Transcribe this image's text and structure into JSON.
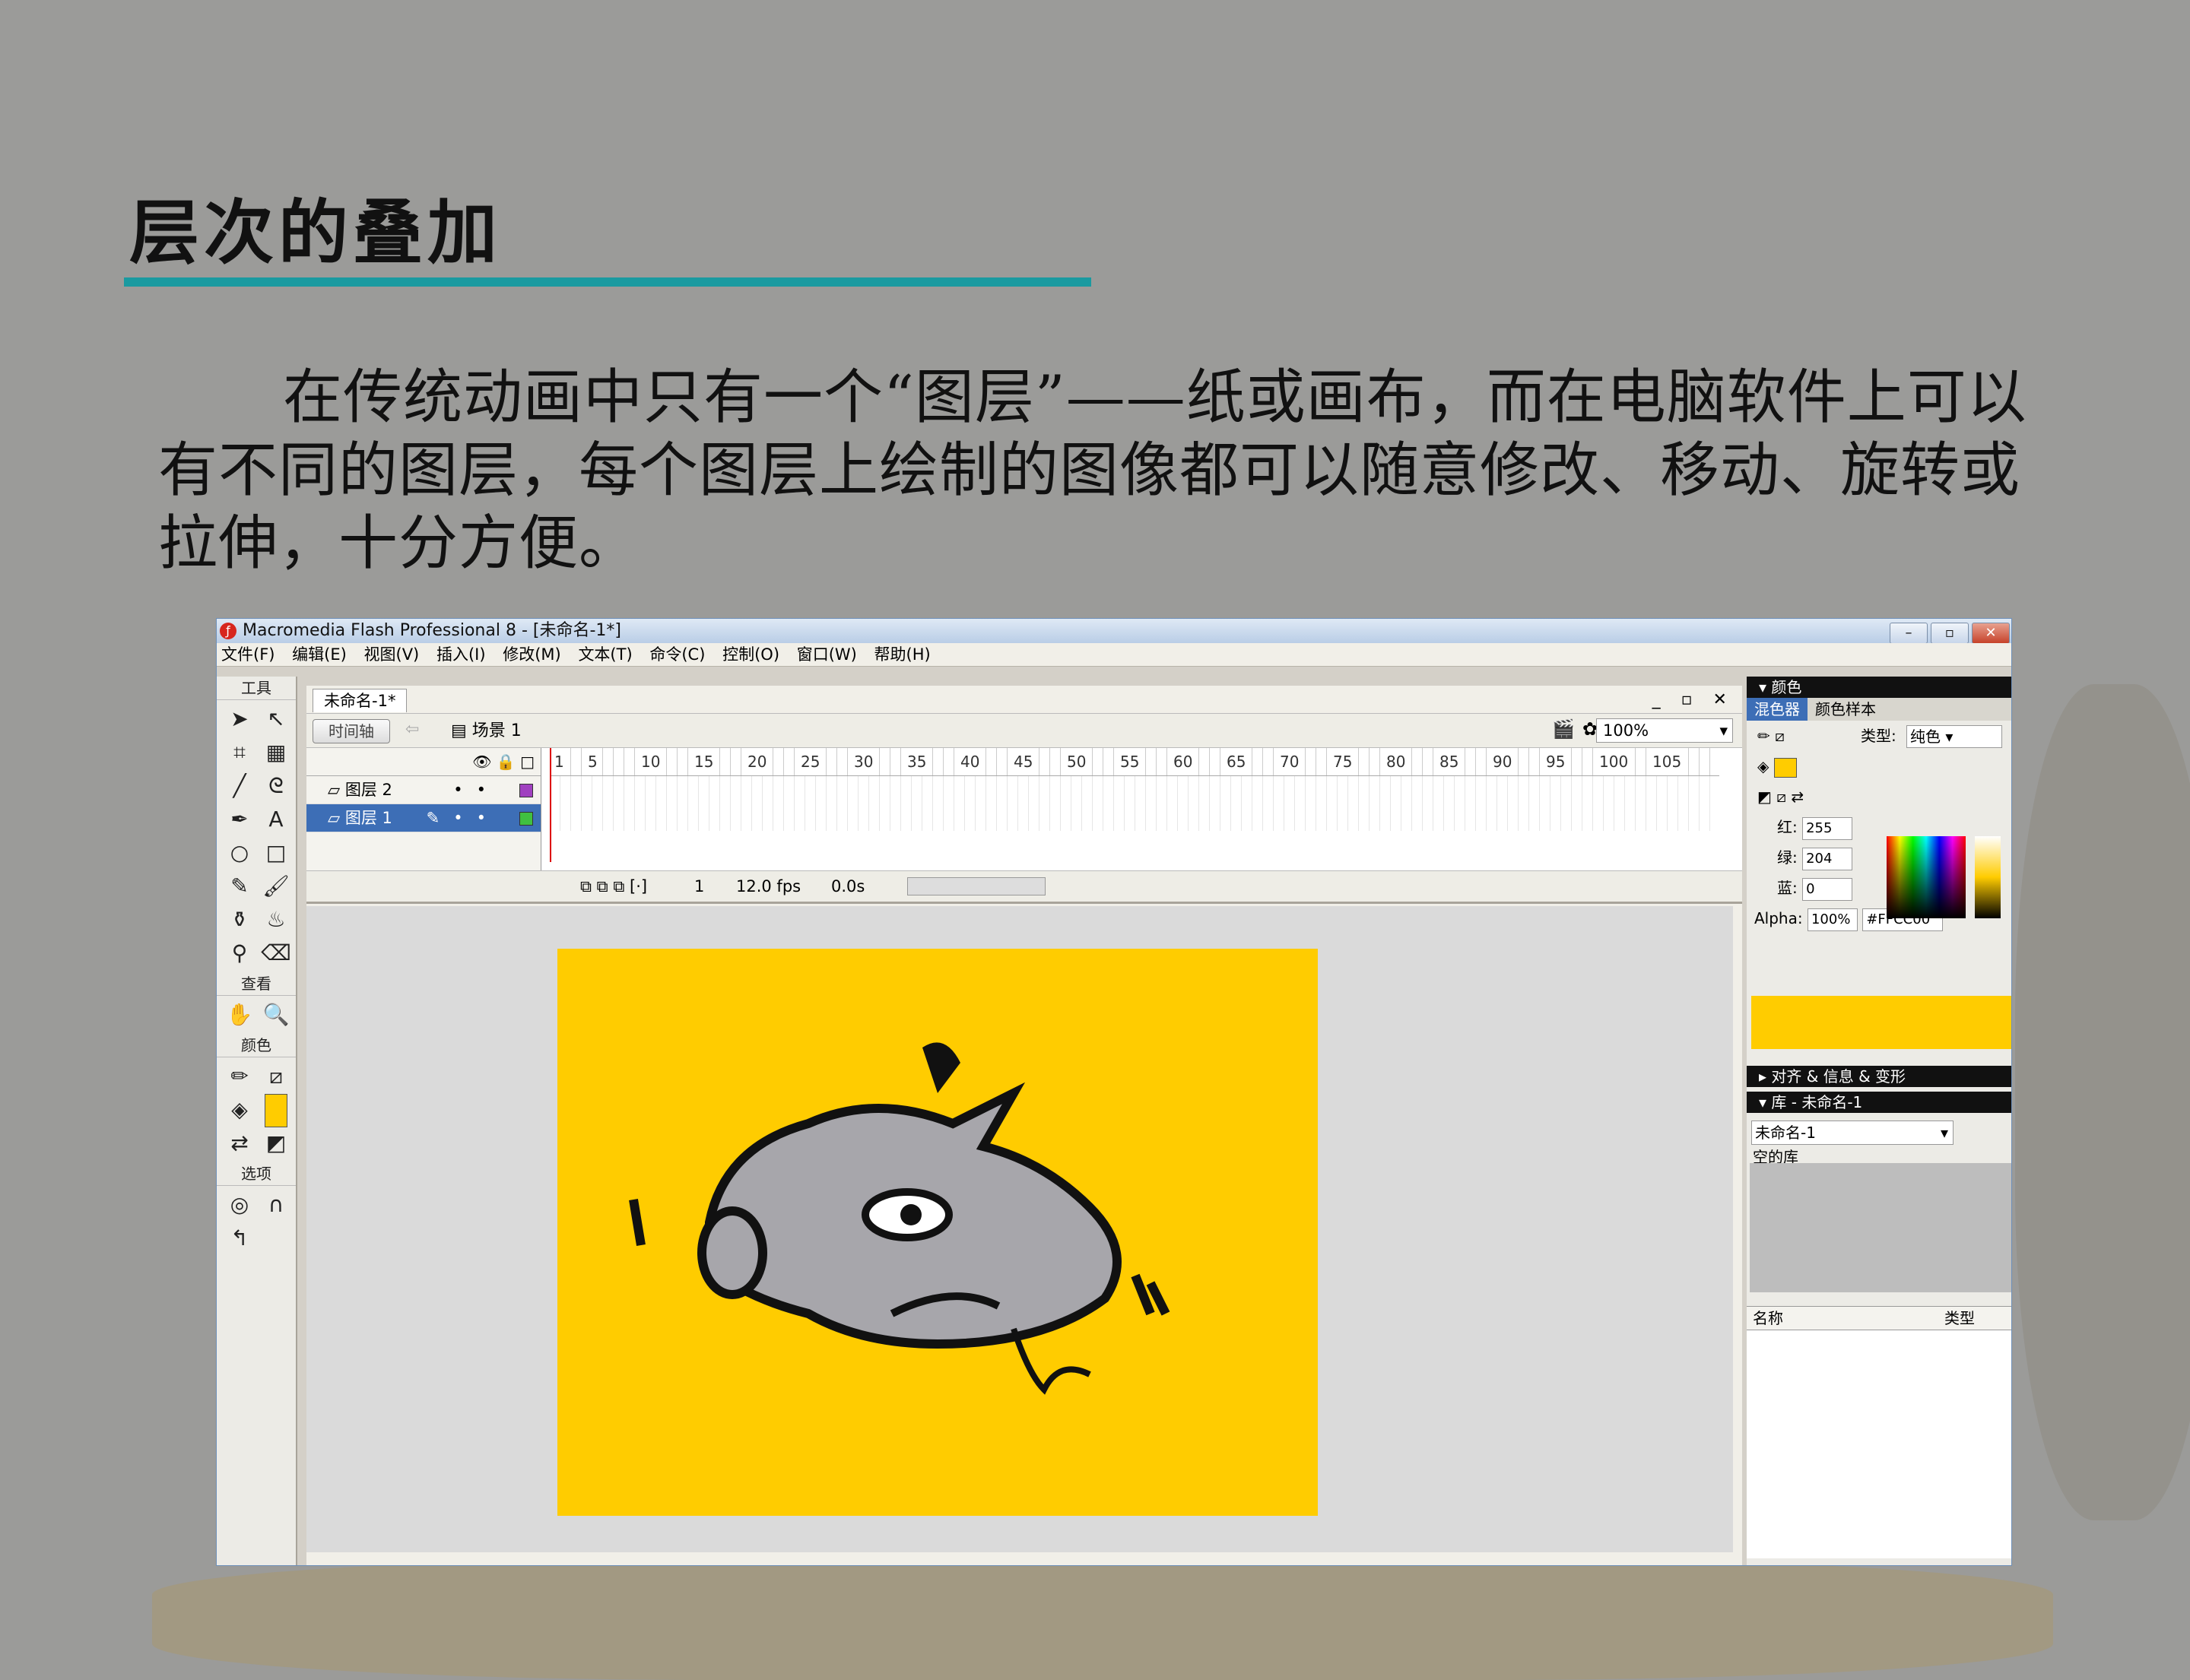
{
  "slide": {
    "title": "层次的叠加",
    "body": "在传统动画中只有一个“图层”——纸或画布，而在电脑软件上可以有不同的图层，每个图层上绘制的图像都可以随意修改、移动、旋转或拉伸，十分方便。",
    "accent_color": "#1a9aa0"
  },
  "window": {
    "title": "Macromedia Flash Professional 8 - [未命名-1*]",
    "menus": [
      "文件(F)",
      "编辑(E)",
      "视图(V)",
      "插入(I)",
      "修改(M)",
      "文本(T)",
      "命令(C)",
      "控制(O)",
      "窗口(W)",
      "帮助(H)"
    ]
  },
  "tools": {
    "header": "工具",
    "view_header": "查看",
    "color_header": "颜色",
    "options_header": "选项"
  },
  "document": {
    "tab": "未命名-1*",
    "timeline_button": "时间轴",
    "scene": "场景 1",
    "zoom": "100%",
    "ruler_ticks": [
      "1",
      "5",
      "10",
      "15",
      "20",
      "25",
      "30",
      "35",
      "40",
      "45",
      "50",
      "55",
      "60",
      "65",
      "70",
      "75",
      "80",
      "85",
      "90",
      "95",
      "100",
      "105"
    ],
    "layers": [
      {
        "name": "图层 2",
        "color": "#a040c0",
        "selected": false
      },
      {
        "name": "图层 1",
        "color": "#40c040",
        "selected": true
      }
    ],
    "frame": "1",
    "fps": "12.0 fps",
    "time": "0.0s",
    "stage_color": "#ffcc00"
  },
  "color_panel": {
    "header": "颜色",
    "tab_mixer": "混色器",
    "tab_swatches": "颜色样本",
    "type_label": "类型:",
    "type_value": "纯色",
    "red_label": "红:",
    "red": "255",
    "green_label": "绿:",
    "green": "204",
    "blue_label": "蓝:",
    "blue": "0",
    "alpha_label": "Alpha:",
    "alpha": "100%",
    "hex": "#FFCC00"
  },
  "align_panel": {
    "header": "对齐 & 信息 & 变形"
  },
  "library_panel": {
    "header": "库 - 未命名-1",
    "doc_select": "未命名-1",
    "empty_text": "空的库",
    "col_name": "名称",
    "col_type": "类型"
  }
}
